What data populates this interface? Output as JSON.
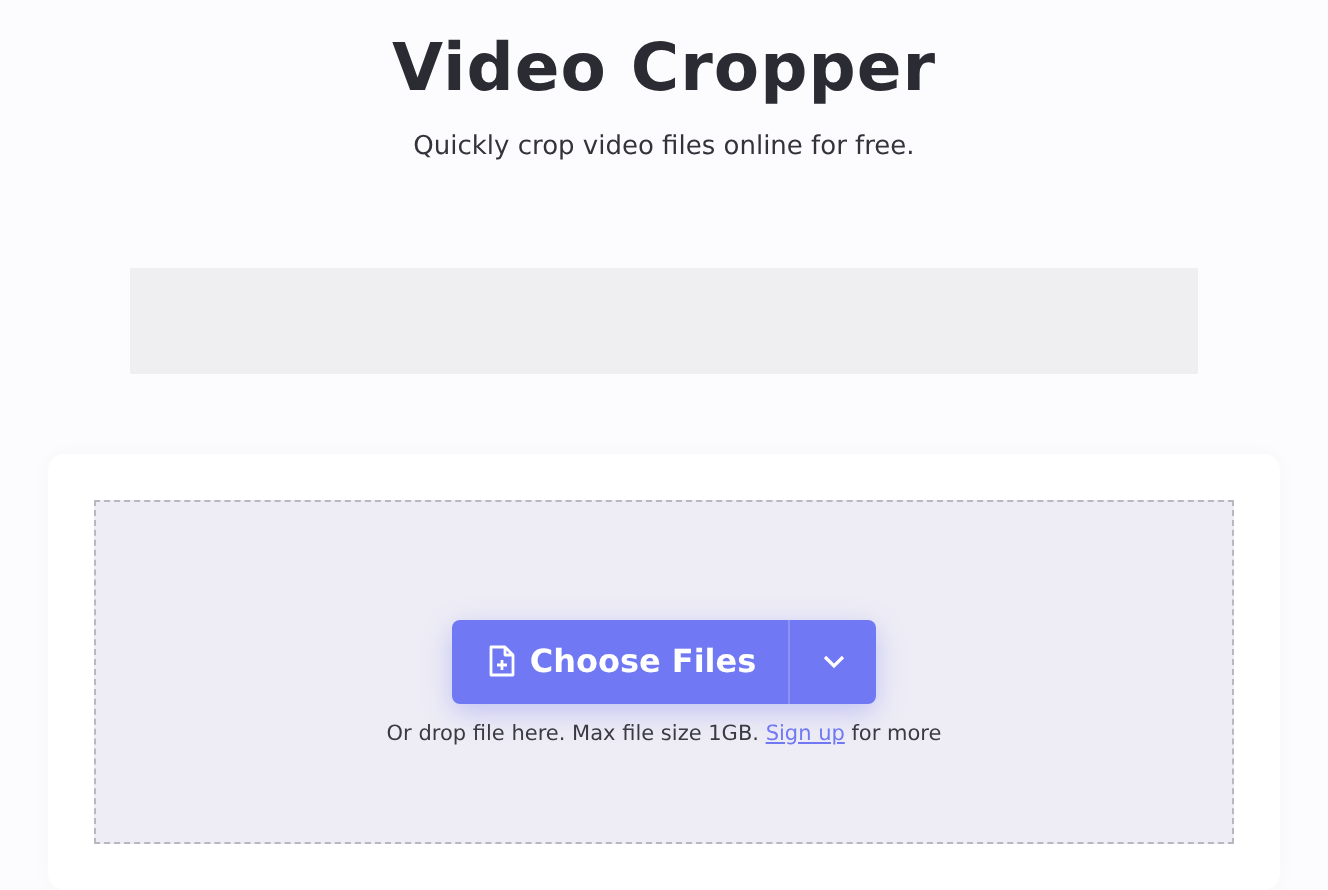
{
  "header": {
    "title": "Video Cropper",
    "subtitle": "Quickly crop video files online for free."
  },
  "upload": {
    "button": "Choose Files",
    "hint_before": "Or drop file here. Max file size 1GB.",
    "hint_link": "Sign up",
    "hint_after": "for more"
  }
}
